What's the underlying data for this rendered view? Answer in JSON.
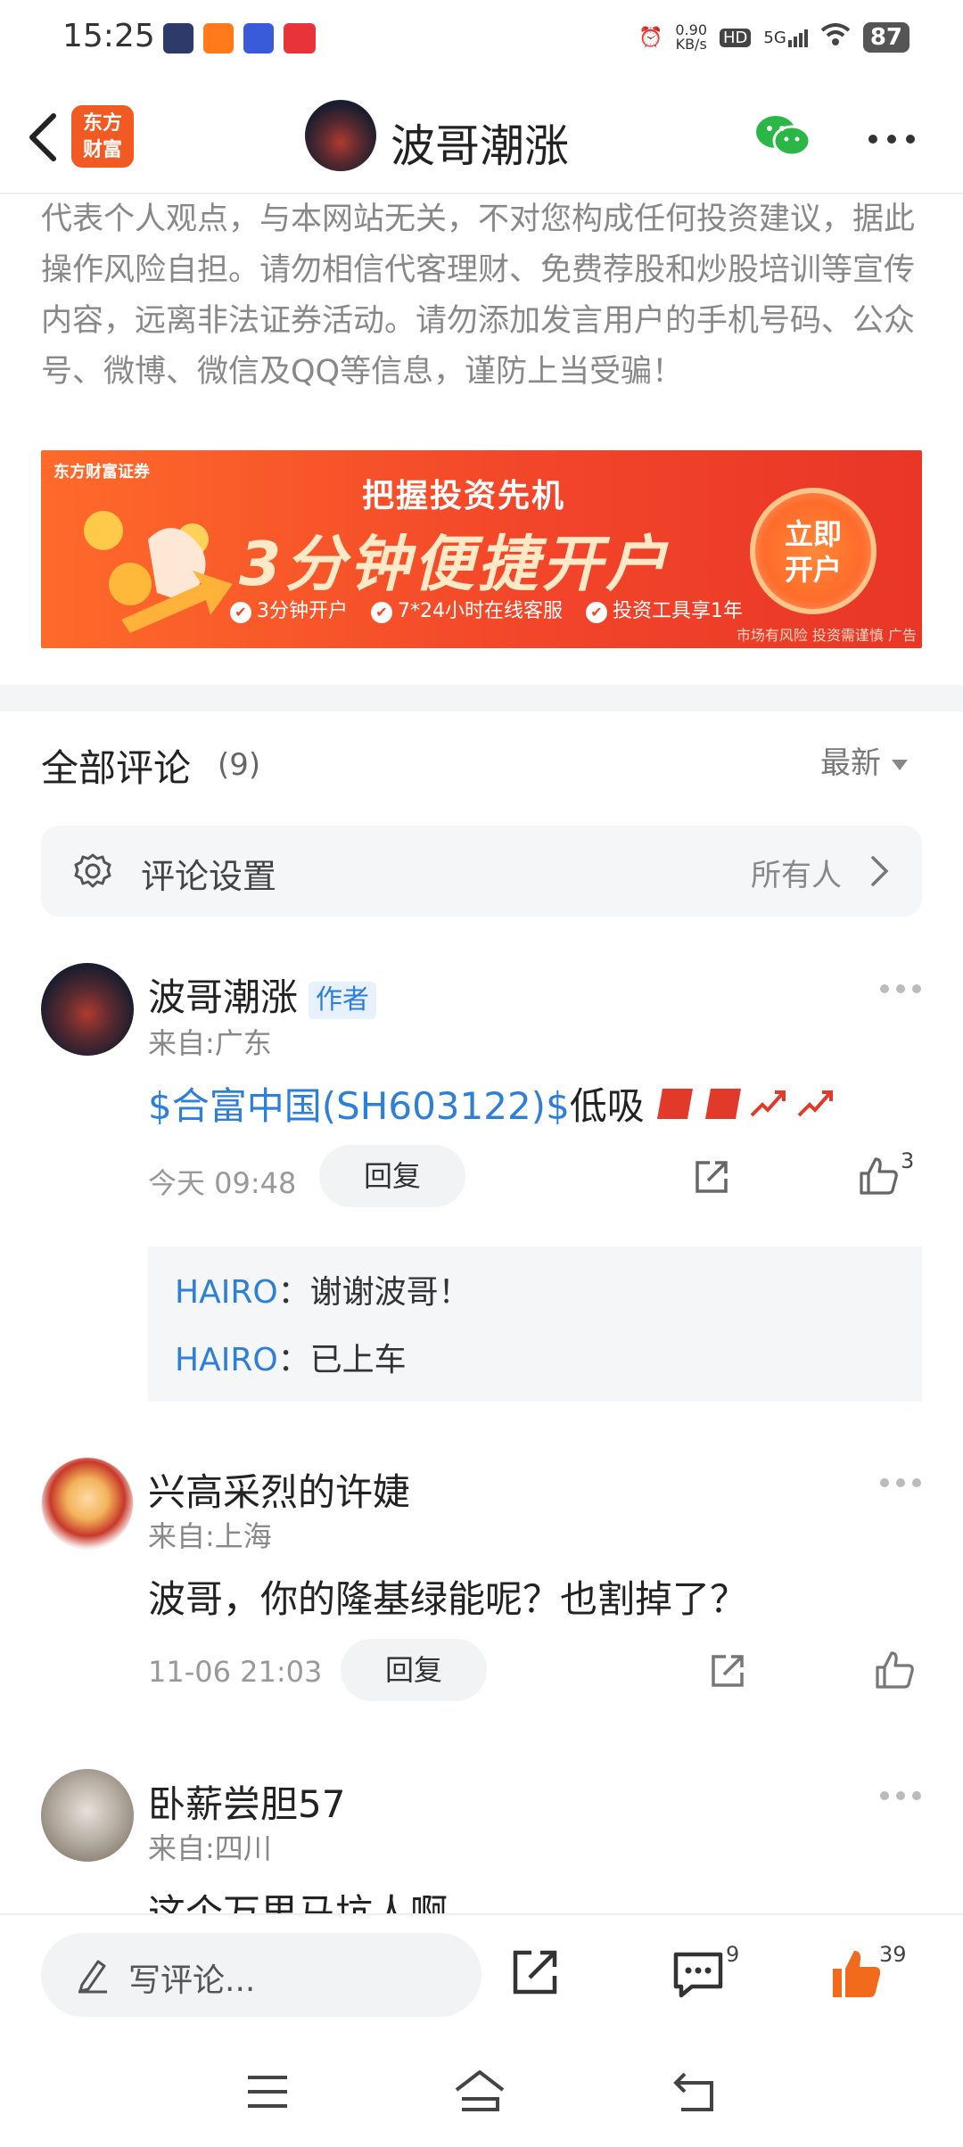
{
  "status_bar": {
    "time": "15:25",
    "net_speed": "0.90\nKB/s",
    "hd": "HD",
    "signal": "5G",
    "battery": "87"
  },
  "header": {
    "logo_text": "东方\n财富",
    "title": "波哥潮涨"
  },
  "disclaimer": "代表个人观点，与本网站无关，不对您构成任何投资建议，据此操作风险自担。请勿相信代客理财、免费荐股和炒股培训等宣传内容，远离非法证券活动。请勿添加发言用户的手机号码、公众号、微博、微信及QQ等信息，谨防上当受骗！",
  "banner": {
    "brand": "东方财富证券",
    "headline": "把握投资先机",
    "main": "3分钟便捷开户",
    "perks": [
      "3分钟开户",
      "7*24小时在线客服",
      "投资工具享1年"
    ],
    "cta": "立即\n开户",
    "risk": "市场有风险 投资需谨慎 广告"
  },
  "comments_header": {
    "title": "全部评论",
    "count": "(9)",
    "sort": "最新"
  },
  "settings": {
    "label": "评论设置",
    "value": "所有人"
  },
  "comments": [
    {
      "name": "波哥潮涨",
      "tag": "作者",
      "from": "来自:广东",
      "stock": "$合富中国(SH603122)$",
      "text": "低吸",
      "time": "今天 09:48",
      "reply": "回复",
      "likes": "3"
    },
    {
      "name": "兴高采烈的许婕",
      "from": "来自:上海",
      "text": "波哥，你的隆基绿能呢？也割掉了？",
      "time": "11-06 21:03",
      "reply": "回复"
    },
    {
      "name": "卧薪尝胆57",
      "from": "来自:四川",
      "text": "这个万里马坑人啊"
    }
  ],
  "sub_replies": [
    {
      "user": "HAIRO",
      "text": "：谢谢波哥！"
    },
    {
      "user": "HAIRO",
      "text": "：已上车"
    }
  ],
  "bottom_bar": {
    "placeholder": "写评论...",
    "comment_count": "9",
    "like_count": "39"
  },
  "colors": {
    "accent_blue": "#2e7fd7",
    "brand_orange": "#f15a22",
    "like_orange": "#f26a1b"
  }
}
